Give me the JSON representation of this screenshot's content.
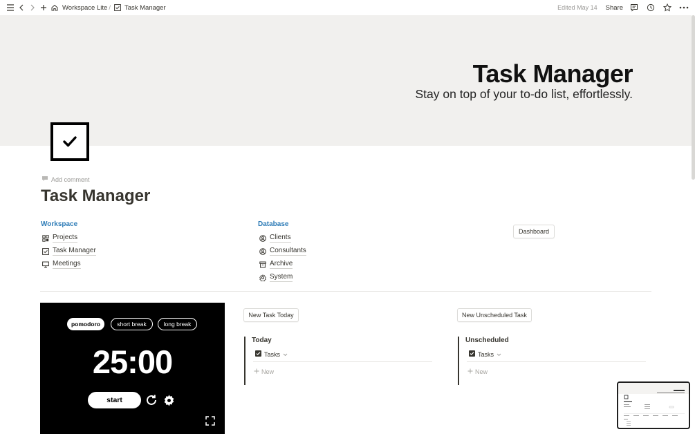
{
  "topbar": {
    "breadcrumb_workspace": "Workspace Lite",
    "breadcrumb_sep": "/",
    "breadcrumb_page": "Task Manager",
    "edited": "Edited May 14",
    "share": "Share"
  },
  "cover": {
    "title": "Task Manager",
    "subtitle": "Stay on top of your to-do list, effortlessly."
  },
  "page": {
    "add_comment": "Add comment",
    "title": "Task Manager"
  },
  "workspace": {
    "heading": "Workspace",
    "items": [
      {
        "label": "Projects",
        "icon": "projects-icon"
      },
      {
        "label": "Task Manager",
        "icon": "checkbox-icon"
      },
      {
        "label": "Meetings",
        "icon": "presentation-icon"
      }
    ]
  },
  "database": {
    "heading": "Database",
    "items": [
      {
        "label": "Clients",
        "icon": "person-circle-icon"
      },
      {
        "label": "Consultants",
        "icon": "person-circle-icon"
      },
      {
        "label": "Archive",
        "icon": "archive-icon"
      },
      {
        "label": "System",
        "icon": "gear-icon"
      }
    ]
  },
  "dashboard_button": "Dashboard",
  "pomodoro": {
    "modes": [
      "pomodoro",
      "short break",
      "long break"
    ],
    "active_mode": "pomodoro",
    "time": "25:00",
    "start_label": "start"
  },
  "today": {
    "button": "New Task Today",
    "title": "Today",
    "view": "Tasks",
    "new": "New"
  },
  "unscheduled": {
    "button": "New Unscheduled Task",
    "title": "Unscheduled",
    "view": "Tasks",
    "new": "New"
  },
  "colors": {
    "link_blue": "#2e7cb7",
    "cover_bg": "#f1f0ee",
    "text": "#37352f"
  }
}
